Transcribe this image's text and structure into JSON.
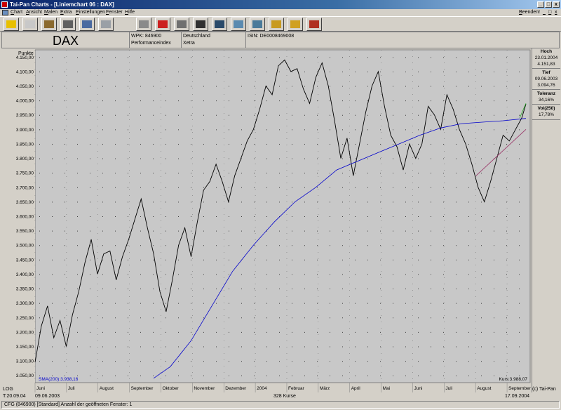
{
  "window": {
    "title": "Tai-Pan  Charts - [Liniemchart 06 : DAX]",
    "close_label": "x",
    "maximize_label": "□",
    "minimize_label": "_"
  },
  "menu": {
    "items": [
      "Chart",
      "Ansicht",
      "Malen",
      "Extra",
      "Einstellungen",
      "Fenster",
      "Hilfe"
    ],
    "beenden": "Beenden!",
    "mdi_controls": [
      "_",
      "□",
      "x"
    ]
  },
  "toolbar": {
    "buttons": [
      "help-icon",
      "book-icon",
      "bars-icon",
      "tools-icon",
      "ruler-icon",
      "magnifier-icon",
      "printer-icon",
      "indicator-icon",
      "pencil-icon",
      "scale-icon",
      "tape-icon",
      "monitor-icon",
      "grid-icon",
      "chart-icon",
      "folder-icon",
      "folder-star-icon",
      "export-icon"
    ]
  },
  "info": {
    "name": "DAX",
    "wpk": "WPK: 846900",
    "type": "Performanceindex",
    "country": "Deutschland",
    "exchange": "Xetra",
    "isin": "ISIN: DE0008469008"
  },
  "stats": {
    "hoch_label": "Hoch",
    "hoch_date": "23.01.2004",
    "hoch_value": "4.151,83",
    "tief_label": "Tief",
    "tief_date": "09.06.2003",
    "tief_value": "3.094,76",
    "toleranz_label": "Toleranz",
    "toleranz_value": "34,16%",
    "vol_label": "Vol(250)",
    "vol_value": "17,78%"
  },
  "chart_data": {
    "type": "line",
    "ylabel": "Punkte",
    "ylim": [
      3025,
      4175
    ],
    "yticks": [
      "3.050,00",
      "3.100,00",
      "3.150,00",
      "3.200,00",
      "3.250,00",
      "3.300,00",
      "3.350,00",
      "3.400,00",
      "3.450,00",
      "3.500,00",
      "3.550,00",
      "3.600,00",
      "3.650,00",
      "3.700,00",
      "3.750,00",
      "3.800,00",
      "3.850,00",
      "3.900,00",
      "3.950,00",
      "4.000,00",
      "4.050,00",
      "4.100,00",
      "4.150,00"
    ],
    "months": [
      "Juni",
      "Juli",
      "August",
      "September",
      "Oktober",
      "November",
      "Dezember",
      "2004",
      "Februar",
      "März",
      "April",
      "Mai",
      "Juni",
      "Juli",
      "August",
      "September"
    ],
    "series": [
      {
        "name": "DAX",
        "color": "#000000",
        "points": [
          [
            0,
            3095
          ],
          [
            3,
            3220
          ],
          [
            6,
            3290
          ],
          [
            9,
            3180
          ],
          [
            12,
            3240
          ],
          [
            15,
            3150
          ],
          [
            18,
            3260
          ],
          [
            21,
            3340
          ],
          [
            24,
            3440
          ],
          [
            27,
            3520
          ],
          [
            30,
            3400
          ],
          [
            33,
            3470
          ],
          [
            36,
            3480
          ],
          [
            39,
            3380
          ],
          [
            42,
            3460
          ],
          [
            45,
            3520
          ],
          [
            48,
            3590
          ],
          [
            51,
            3660
          ],
          [
            54,
            3560
          ],
          [
            57,
            3470
          ],
          [
            60,
            3340
          ],
          [
            63,
            3270
          ],
          [
            66,
            3380
          ],
          [
            69,
            3500
          ],
          [
            72,
            3560
          ],
          [
            75,
            3460
          ],
          [
            78,
            3580
          ],
          [
            81,
            3690
          ],
          [
            84,
            3720
          ],
          [
            87,
            3780
          ],
          [
            90,
            3720
          ],
          [
            93,
            3650
          ],
          [
            96,
            3740
          ],
          [
            99,
            3800
          ],
          [
            102,
            3860
          ],
          [
            105,
            3900
          ],
          [
            108,
            3970
          ],
          [
            111,
            4050
          ],
          [
            114,
            4020
          ],
          [
            117,
            4120
          ],
          [
            120,
            4140
          ],
          [
            123,
            4100
          ],
          [
            126,
            4110
          ],
          [
            129,
            4040
          ],
          [
            132,
            3990
          ],
          [
            135,
            4080
          ],
          [
            138,
            4130
          ],
          [
            141,
            4050
          ],
          [
            144,
            3930
          ],
          [
            147,
            3800
          ],
          [
            150,
            3870
          ],
          [
            153,
            3740
          ],
          [
            156,
            3850
          ],
          [
            159,
            3960
          ],
          [
            162,
            4050
          ],
          [
            165,
            4100
          ],
          [
            168,
            3980
          ],
          [
            171,
            3880
          ],
          [
            174,
            3840
          ],
          [
            177,
            3760
          ],
          [
            180,
            3850
          ],
          [
            183,
            3800
          ],
          [
            186,
            3850
          ],
          [
            189,
            3980
          ],
          [
            192,
            3950
          ],
          [
            195,
            3900
          ],
          [
            198,
            4020
          ],
          [
            201,
            3970
          ],
          [
            204,
            3900
          ],
          [
            207,
            3850
          ],
          [
            210,
            3780
          ],
          [
            213,
            3700
          ],
          [
            216,
            3650
          ],
          [
            219,
            3720
          ],
          [
            222,
            3800
          ],
          [
            225,
            3880
          ],
          [
            228,
            3860
          ],
          [
            231,
            3900
          ],
          [
            234,
            3940
          ],
          [
            236,
            3988
          ]
        ]
      },
      {
        "name": "SMA(200): 3.938,16",
        "color": "#0000cc",
        "points": [
          [
            57,
            3040
          ],
          [
            65,
            3080
          ],
          [
            75,
            3170
          ],
          [
            85,
            3290
          ],
          [
            95,
            3410
          ],
          [
            105,
            3500
          ],
          [
            115,
            3580
          ],
          [
            125,
            3650
          ],
          [
            135,
            3700
          ],
          [
            145,
            3760
          ],
          [
            155,
            3790
          ],
          [
            165,
            3820
          ],
          [
            175,
            3850
          ],
          [
            185,
            3880
          ],
          [
            195,
            3905
          ],
          [
            205,
            3920
          ],
          [
            215,
            3925
          ],
          [
            225,
            3930
          ],
          [
            236,
            3938
          ]
        ]
      },
      {
        "name": "trend-line",
        "color": "#993366",
        "points": [
          [
            212,
            3740
          ],
          [
            236,
            3900
          ]
        ]
      },
      {
        "name": "projection",
        "color": "#22aa22",
        "points": [
          [
            233,
            3940
          ],
          [
            236,
            3990
          ]
        ]
      }
    ],
    "sma_label": "SMA(200):3.938,16",
    "kurs_label": "Kurs:3.988,07",
    "grid": true,
    "x_count": 328
  },
  "bottom": {
    "log": "LOG",
    "start": "T:20.09.04",
    "start_date": "09.06.2003",
    "kurse": "328 Kurse",
    "end_date": "17.09.2004",
    "copyright": "(c) Tai-Pan"
  },
  "status": "CFG (846900) [Standard]  Anzahl der geöffneten Fenster: 1"
}
